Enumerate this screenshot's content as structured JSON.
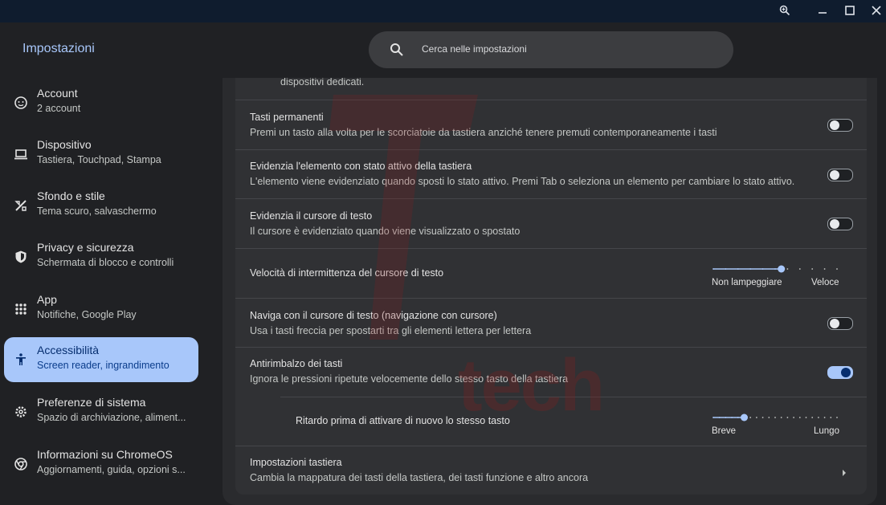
{
  "window": {
    "zoom_icon": "zoom-icon",
    "minimize_icon": "minimize-icon",
    "maximize_icon": "maximize-icon",
    "close_icon": "close-icon"
  },
  "app": {
    "title": "Impostazioni"
  },
  "search": {
    "placeholder": "Cerca nelle impostazioni",
    "icon": "search-icon"
  },
  "sidebar": {
    "items": [
      {
        "label": "Account",
        "sub": "2 account",
        "icon": "account-icon",
        "active": false
      },
      {
        "label": "Dispositivo",
        "sub": "Tastiera, Touchpad, Stampa",
        "icon": "laptop-icon",
        "active": false
      },
      {
        "label": "Sfondo e stile",
        "sub": "Tema scuro, salvaschermo",
        "icon": "palette-icon",
        "active": false
      },
      {
        "label": "Privacy e sicurezza",
        "sub": "Schermata di blocco e controlli",
        "icon": "shield-icon",
        "active": false
      },
      {
        "label": "App",
        "sub": "Notifiche, Google Play",
        "icon": "apps-grid-icon",
        "active": false
      },
      {
        "label": "Accessibilità",
        "sub": "Screen reader, ingrandimento",
        "icon": "accessibility-icon",
        "active": true
      },
      {
        "label": "Preferenze di sistema",
        "sub": "Spazio di archiviazione, aliment...",
        "icon": "gear-icon",
        "active": false
      },
      {
        "label": "Informazioni su ChromeOS",
        "sub": "Aggiornamenti, guida, opzioni s...",
        "icon": "chrome-icon",
        "active": false
      }
    ]
  },
  "content": {
    "partial_text": "dispositivi dedicati.",
    "rows": [
      {
        "title": "Tasti permanenti",
        "sub": "Premi un tasto alla volta per le scorciatoie da tastiera anziché tenere premuti contemporaneamente i tasti",
        "toggle": false
      },
      {
        "title": "Evidenzia l'elemento con stato attivo della tastiera",
        "sub": "L'elemento viene evidenziato quando sposti lo stato attivo. Premi Tab o seleziona un elemento per cambiare lo stato attivo.",
        "toggle": false
      },
      {
        "title": "Evidenzia il cursore di testo",
        "sub": "Il cursore è evidenziato quando viene visualizzato o spostato",
        "toggle": false
      },
      {
        "title": "Velocità di intermittenza del cursore di testo",
        "slider": {
          "min_label": "Non lampeggiare",
          "max_label": "Veloce",
          "ticks": 10,
          "position": 0.55
        }
      },
      {
        "title": "Naviga con il cursore di testo (navigazione con cursore)",
        "sub": "Usa i tasti freccia per spostarti tra gli elementi lettera per lettera",
        "toggle": false
      },
      {
        "title": "Antirimbalzo dei tasti",
        "sub": "Ignora le pressioni ripetute velocemente dello stesso tasto della tastiera",
        "toggle": true
      },
      {
        "title": "Ritardo prima di attivare di nuovo lo stesso tasto",
        "slider": {
          "min_label": "Breve",
          "max_label": "Lungo",
          "ticks": 20,
          "position": 0.25
        }
      },
      {
        "title": "Impostazioni tastiera",
        "sub": "Cambia la mappatura dei tasti della tastiera, dei tasti funzione e altro ancora",
        "icon": "chevron-right-icon"
      }
    ]
  },
  "watermark": {
    "text": "tech",
    "color": "#8b1e1e"
  },
  "colors": {
    "accent": "#a8c7fa",
    "background": "#202124",
    "card": "#303134"
  }
}
